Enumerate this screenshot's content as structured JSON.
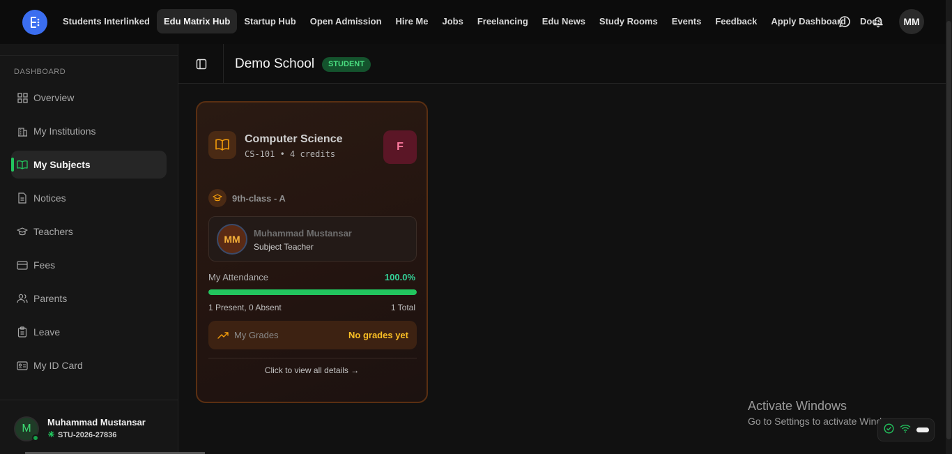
{
  "topbar": {
    "nav": [
      {
        "label": "Students Interlinked",
        "active": false
      },
      {
        "label": "Edu Matrix Hub",
        "active": true
      },
      {
        "label": "Startup Hub",
        "active": false
      },
      {
        "label": "Open Admission",
        "active": false
      },
      {
        "label": "Hire Me",
        "active": false
      },
      {
        "label": "Jobs",
        "active": false
      },
      {
        "label": "Freelancing",
        "active": false
      },
      {
        "label": "Edu News",
        "active": false
      },
      {
        "label": "Study Rooms",
        "active": false
      },
      {
        "label": "Events",
        "active": false
      },
      {
        "label": "Feedback",
        "active": false
      },
      {
        "label": "Apply Dashboard",
        "active": false
      },
      {
        "label": "Docs",
        "active": false
      }
    ],
    "avatar_initials": "MM",
    "icons": [
      "chat-icon",
      "bell-icon"
    ]
  },
  "sidebar": {
    "section_label": "DASHBOARD",
    "items": [
      {
        "label": "Overview",
        "icon": "grid-icon",
        "active": false
      },
      {
        "label": "My Institutions",
        "icon": "building-icon",
        "active": false
      },
      {
        "label": "My Subjects",
        "icon": "book-open-icon",
        "active": true
      },
      {
        "label": "Notices",
        "icon": "file-text-icon",
        "active": false
      },
      {
        "label": "Teachers",
        "icon": "teacher-icon",
        "active": false
      },
      {
        "label": "Fees",
        "icon": "wallet-icon",
        "active": false
      },
      {
        "label": "Parents",
        "icon": "users-icon",
        "active": false
      },
      {
        "label": "Leave",
        "icon": "clipboard-icon",
        "active": false
      },
      {
        "label": "My ID Card",
        "icon": "id-card-icon",
        "active": false
      }
    ],
    "user": {
      "initial": "M",
      "name": "Muhammad Mustansar",
      "id": "STU-2026-27836"
    }
  },
  "header": {
    "school_name": "Demo School",
    "role_badge": "STUDENT"
  },
  "subject_card": {
    "title": "Computer Science",
    "meta": "CS-101 • 4 credits",
    "grade_letter": "F",
    "class_name": "9th-class - A",
    "teacher": {
      "initials": "MM",
      "name": "Muhammad Mustansar",
      "role": "Subject Teacher"
    },
    "attendance": {
      "label": "My Attendance",
      "percent_text": "100.0%",
      "percent": 100,
      "detail": "1 Present, 0 Absent",
      "total": "1 Total"
    },
    "grades": {
      "label": "My Grades",
      "value": "No grades yet"
    },
    "view_link": "Click to view all details →"
  },
  "watermark": {
    "title": "Activate Windows",
    "subtitle": "Go to Settings to activate Windows."
  },
  "colors": {
    "accent_green": "#22c55e",
    "brand_blue": "#3b6ef0",
    "grades_amber": "#fbbf24",
    "card_border": "#5a2f12"
  }
}
